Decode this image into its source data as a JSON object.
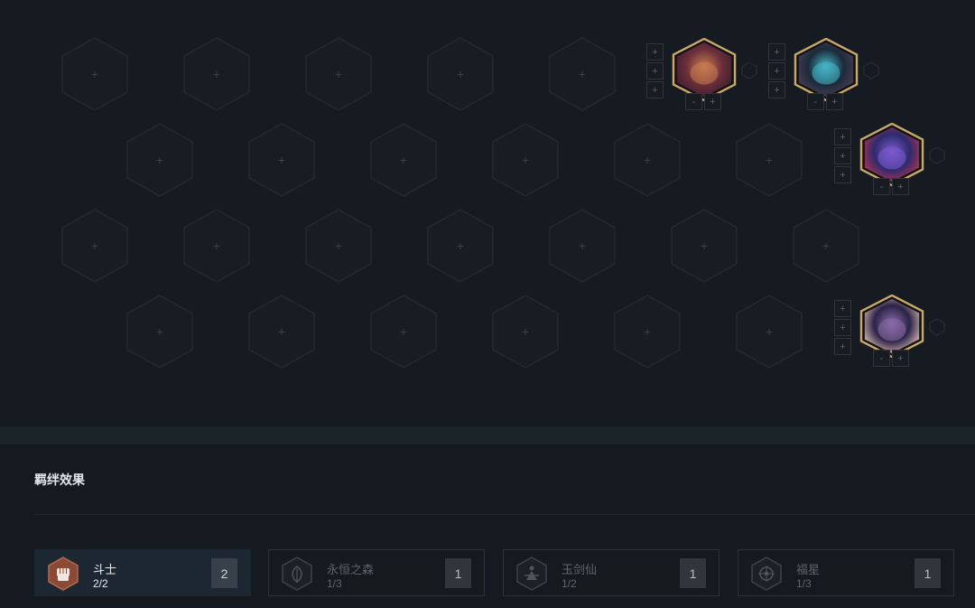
{
  "board": {
    "empty_slot_symbol": "+",
    "side_plus": "+",
    "side_minus": "-",
    "units": [
      {
        "name": "tahm-kench",
        "colors": [
          "#6b2f3a",
          "#c77b4f",
          "#3d1d2f"
        ]
      },
      {
        "name": "maokai-shadow",
        "colors": [
          "#1b2a3a",
          "#46b7c9",
          "#4b3f52"
        ]
      },
      {
        "name": "kayn",
        "colors": [
          "#2e2a6e",
          "#7d5bd0",
          "#b03450"
        ]
      },
      {
        "name": "syndra",
        "colors": [
          "#2c2448",
          "#8a6ca8",
          "#d8b7b0"
        ]
      }
    ]
  },
  "synergy": {
    "title": "羁绊效果",
    "traits": [
      {
        "name": "斗士",
        "count": "2/2",
        "badge": "2",
        "active": true,
        "icon": "fist-icon"
      },
      {
        "name": "永恒之森",
        "count": "1/3",
        "badge": "1",
        "active": false,
        "icon": "leaf-icon"
      },
      {
        "name": "玉剑仙",
        "count": "1/2",
        "badge": "1",
        "active": false,
        "icon": "swordsman-icon"
      },
      {
        "name": "福星",
        "count": "1/3",
        "badge": "1",
        "active": false,
        "icon": "fortune-icon"
      }
    ]
  },
  "colors": {
    "gold_border": "#c9a86a",
    "active_trait_hex": "#8b4a36"
  }
}
